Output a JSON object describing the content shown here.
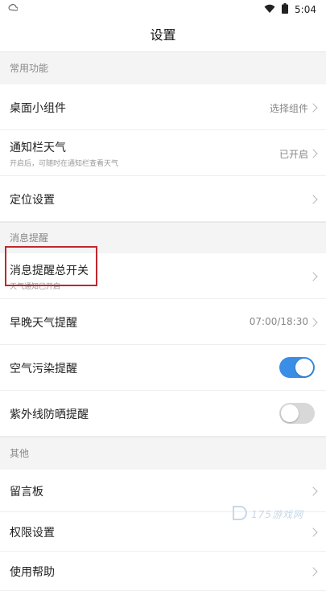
{
  "status_bar": {
    "time": "5:04"
  },
  "title": "设置",
  "sections": {
    "common": "常用功能",
    "reminders": "消息提醒",
    "other": "其他"
  },
  "rows": {
    "widget": {
      "title": "桌面小组件",
      "value": "选择组件"
    },
    "notif_weather": {
      "title": "通知栏天气",
      "subtitle": "开启后，可随时在通知栏查看天气",
      "value": "已开启"
    },
    "location": {
      "title": "定位设置"
    },
    "reminder_master": {
      "title": "消息提醒总开关",
      "subtitle": "天气通知已开启"
    },
    "morning_evening": {
      "title": "早晚天气提醒",
      "value": "07:00/18:30"
    },
    "air_pollution": {
      "title": "空气污染提醒",
      "enabled": true
    },
    "uv": {
      "title": "紫外线防晒提醒",
      "enabled": false
    },
    "message_board": {
      "title": "留言板"
    },
    "permissions": {
      "title": "权限设置"
    },
    "help": {
      "title": "使用帮助"
    }
  },
  "watermark": "175游戏网",
  "colors": {
    "accent": "#3b8ee6",
    "highlight": "#c0272d",
    "toggle_off": "#d8d8d8"
  }
}
